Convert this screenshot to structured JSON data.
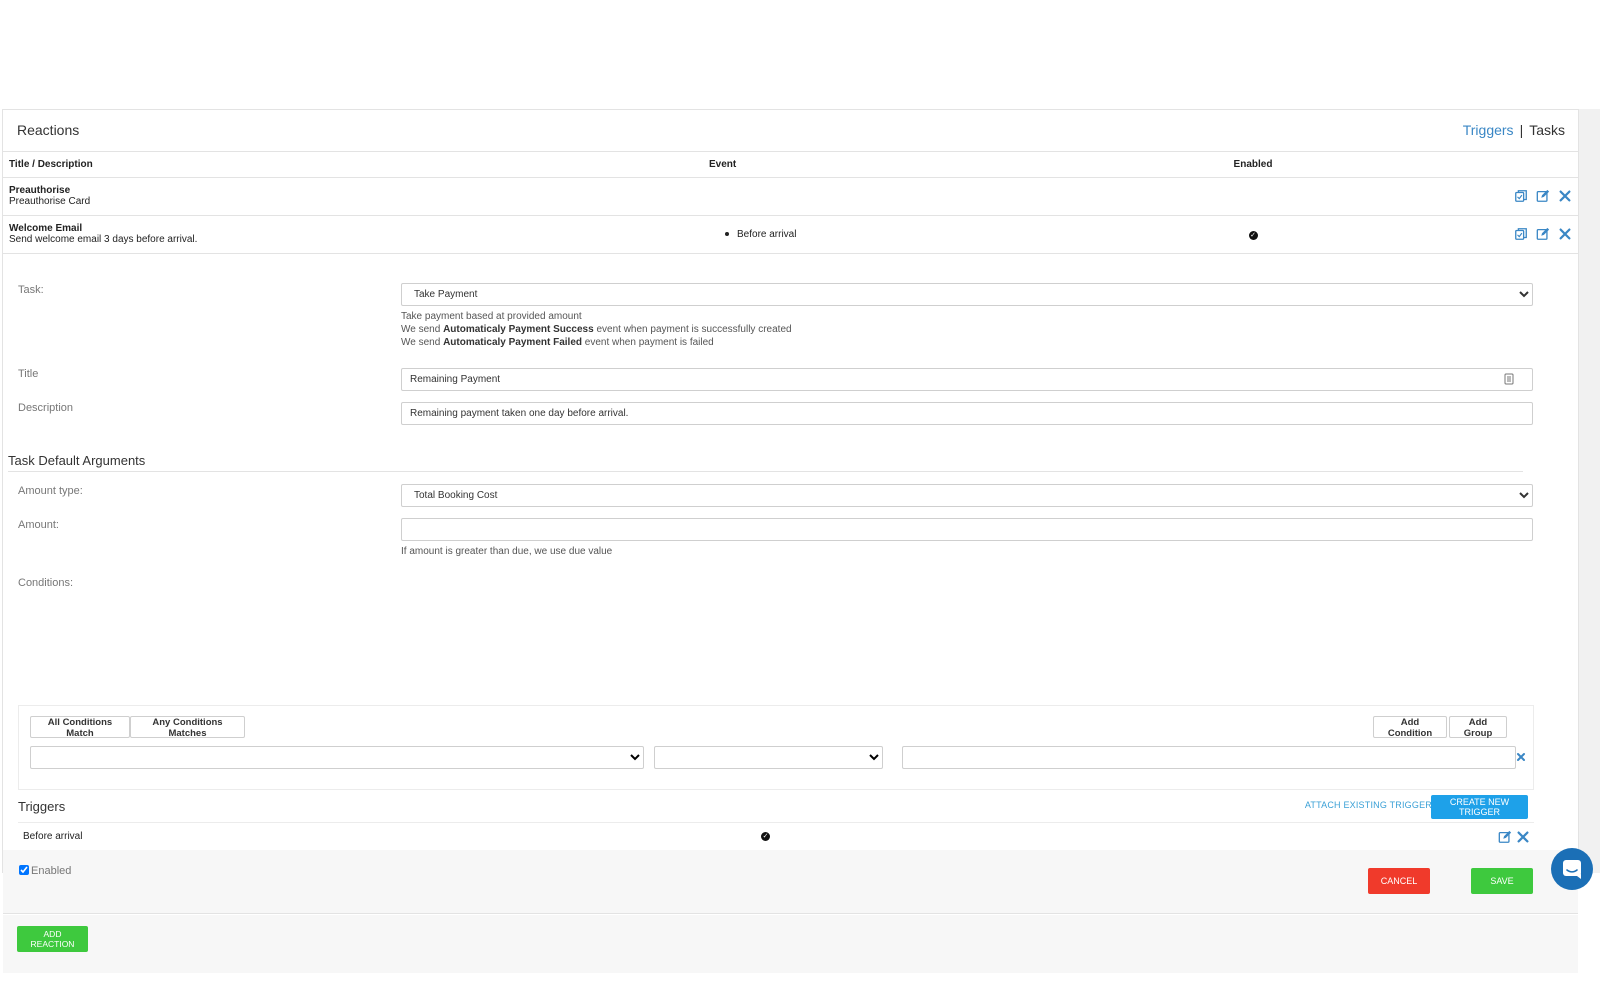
{
  "header": {
    "title": "Reactions",
    "nav_triggers": "Triggers",
    "nav_sep": "|",
    "nav_tasks": "Tasks"
  },
  "table": {
    "columns": [
      "Title / Description",
      "Event",
      "Enabled"
    ],
    "rows": [
      {
        "title": "Preauthorise",
        "description": "Preauthorise Card",
        "event": "",
        "enabled": false
      },
      {
        "title": "Welcome Email",
        "description": "Send welcome email 3 days before arrival.",
        "event": "Before arrival",
        "enabled": true
      }
    ]
  },
  "form": {
    "task_label": "Task:",
    "task_value": "Take Payment",
    "task_help_1": "Take payment based at provided amount",
    "task_help_2_pre": "We send ",
    "task_help_2_bold": "Automaticaly Payment Success",
    "task_help_2_post": " event when payment is successfully created",
    "task_help_3_pre": "We send ",
    "task_help_3_bold": "Automaticaly Payment Failed",
    "task_help_3_post": " event when payment is failed",
    "title_label": "Title",
    "title_value": "Remaining Payment",
    "description_label": "Description",
    "description_value": "Remaining payment taken one day before arrival.",
    "section_title": "Task Default Arguments",
    "amount_type_label": "Amount type:",
    "amount_type_value": "Total Booking Cost",
    "amount_label": "Amount:",
    "amount_value": "",
    "amount_help": "If amount is greater than due, we use due value",
    "conditions_label": "Conditions:"
  },
  "conditions": {
    "all_match": "All Conditions Match",
    "any_match": "Any Conditions Matches",
    "add_condition": "Add Condition",
    "add_group": "Add Group"
  },
  "triggers": {
    "heading": "Triggers",
    "attach_existing": "ATTACH EXISTING TRIGGER",
    "create_new": "CREATE NEW TRIGGER",
    "rows": [
      {
        "name": "Before arrival",
        "enabled": true
      }
    ]
  },
  "footer": {
    "enabled_label": "Enabled",
    "enabled_checked": true,
    "cancel": "CANCEL",
    "save": "SAVE"
  },
  "bottom": {
    "add_reaction": "ADD REACTION"
  },
  "colors": {
    "link": "#3a87c5",
    "primary": "#1ea1e9",
    "danger": "#f03a2b",
    "success": "#3ec93e"
  }
}
